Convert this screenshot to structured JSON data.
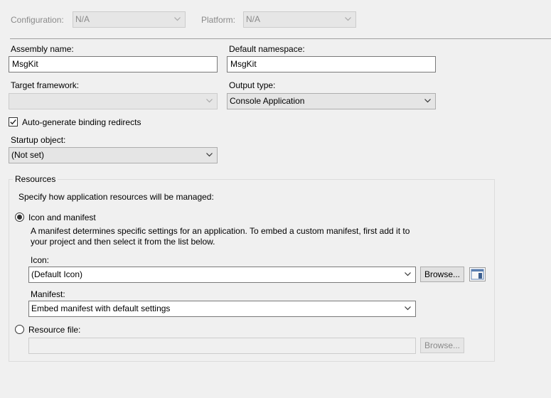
{
  "top": {
    "configuration_label": "Configuration:",
    "configuration_value": "N/A",
    "platform_label": "Platform:",
    "platform_value": "N/A"
  },
  "application": {
    "assembly_name_label": "Assembly name:",
    "assembly_name_value": "MsgKit",
    "default_namespace_label": "Default namespace:",
    "default_namespace_value": "MsgKit",
    "target_framework_label": "Target framework:",
    "target_framework_value": "",
    "output_type_label": "Output type:",
    "output_type_value": "Console Application",
    "auto_binding_label": "Auto-generate binding redirects",
    "auto_binding_checked": true,
    "startup_object_label": "Startup object:",
    "startup_object_value": "(Not set)"
  },
  "resources": {
    "group_title": "Resources",
    "intro": "Specify how application resources will be managed:",
    "icon_manifest_label": "Icon and manifest",
    "icon_manifest_selected": true,
    "description": "A manifest determines specific settings for an application. To embed a custom manifest, first add it to your project and then select it from the list below.",
    "icon_label": "Icon:",
    "icon_value": "(Default Icon)",
    "browse_label": "Browse...",
    "manifest_label": "Manifest:",
    "manifest_value": "Embed manifest with default settings",
    "resource_file_label": "Resource file:",
    "resource_file_value": "",
    "resource_browse_label": "Browse..."
  },
  "icons": {
    "dropdown": "chevron-down-icon",
    "checkbox": "checkmark-icon",
    "icon_preview": "application-icon"
  }
}
